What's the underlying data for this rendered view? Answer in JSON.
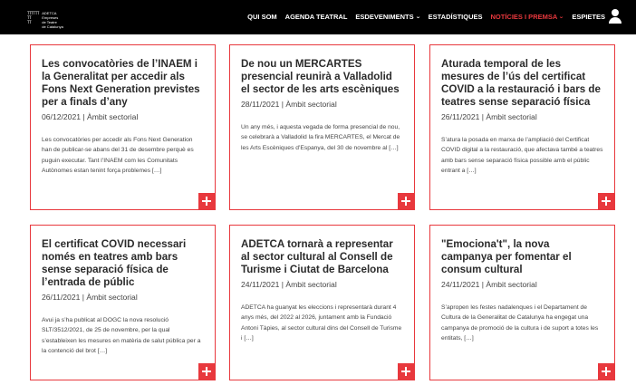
{
  "logo": {
    "mark": "TTTTTT\nTT\nTT",
    "text": "ADETCA\nEmpreses\nde Teatre\nde Catalunya"
  },
  "nav": {
    "items": [
      {
        "label": "QUI SOM",
        "dropdown": false,
        "active": false
      },
      {
        "label": "AGENDA TEATRAL",
        "dropdown": false,
        "active": false
      },
      {
        "label": "ESDEVENIMENTS",
        "dropdown": true,
        "active": false
      },
      {
        "label": "ESTADÍSTIQUES",
        "dropdown": false,
        "active": false
      },
      {
        "label": "NOTÍCIES I PREMSA",
        "dropdown": true,
        "active": true
      },
      {
        "label": "ESPIETES",
        "dropdown": false,
        "active": false
      }
    ],
    "user_icon": "user-icon"
  },
  "colors": {
    "accent": "#e8383d",
    "navbar": "#000000"
  },
  "posts": [
    {
      "title": "Les convocatòries de l’INAEM i la Generalitat per accedir als Fons Next Generation previstes per a finals d’any",
      "meta": "06/12/2021 | Àmbit sectorial",
      "excerpt": "Les convocatòries per accedir als Fons Next Generation han de publicar-se abans del 31 de desembre perquè es puguin executar. Tant l’INAEM com les Comunitats Autònomes estan tenint força problemes […]"
    },
    {
      "title": "De nou un MERCARTES presencial reunirà a Valladolid el sector de les arts escèniques",
      "meta": "28/11/2021 | Àmbit sectorial",
      "excerpt": "Un any més, i aquesta vegada de forma presencial de nou, se celebrarà a Valladolid la fira MERCARTES, el Mercat de les Arts Escèniques d’Espanya, del 30 de novembre al […]"
    },
    {
      "title": "Aturada temporal de les mesures de l’ús del certificat COVID a la restauració i bars de teatres sense separació física",
      "meta": "26/11/2021 | Àmbit sectorial",
      "excerpt": "S’atura la posada en marxa de l’ampliació del Certificat COVID digital a la restauració, que afectava també a teatres amb bars sense separació física possible amb el públic entrant a […]"
    },
    {
      "title": "El certificat COVID necessari només en teatres amb bars sense separació física de l’entrada de públic",
      "meta": "26/11/2021 | Àmbit sectorial",
      "excerpt": "Avui ja s’ha publicat al DOGC la nova resolució SLT/3512/2021, de 25 de novembre, per la qual s’estableixen les mesures en matèria de salut pública per a la contenció del brot […]"
    },
    {
      "title": "ADETCA tornarà a representar al sector cultural al Consell de Turisme i Ciutat de Barcelona",
      "meta": "24/11/2021 | Àmbit sectorial",
      "excerpt": "ADETCA ha guanyat les eleccions i representarà durant 4 anys més, del 2022 al 2026, juntament amb la Fundació Antoni Tàpies, al sector cultural dins del Consell de Turisme i […]"
    },
    {
      "title": "\"Emociona't\", la nova campanya per fomentar el consum cultural",
      "meta": "24/11/2021 | Àmbit sectorial",
      "excerpt": "S’apropen les festes nadalenques i el Departament de Cultura de la Generalitat de Catalunya ha engegat una campanya de promoció de la cultura i de suport a totes les entitats, […]"
    }
  ]
}
